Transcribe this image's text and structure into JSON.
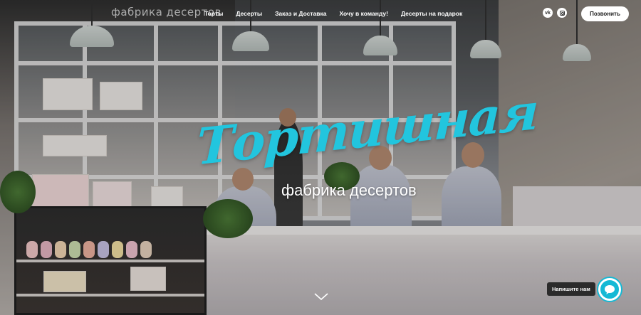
{
  "nav": {
    "logo": "фабрика десертов",
    "links": [
      "Торты",
      "Десерты",
      "Заказ и Доставка",
      "Хочу в команду!",
      "Десерты на подарок"
    ],
    "social": {
      "vk_label": "vk",
      "vk_icon": "vk-icon",
      "ig_icon": "instagram-icon"
    },
    "call_button": "Позвонить"
  },
  "hero": {
    "brand": "Тортишная",
    "tagline": "фабрика десертов",
    "scroll_icon": "chevron-down-icon"
  },
  "chat": {
    "label": "Напишите нам",
    "icon": "chat-bubble-icon",
    "accent": "#14b9d5"
  },
  "colors": {
    "brand_script": "#22c5de",
    "nav_text": "#ffffff",
    "button_bg": "#ffffff"
  }
}
